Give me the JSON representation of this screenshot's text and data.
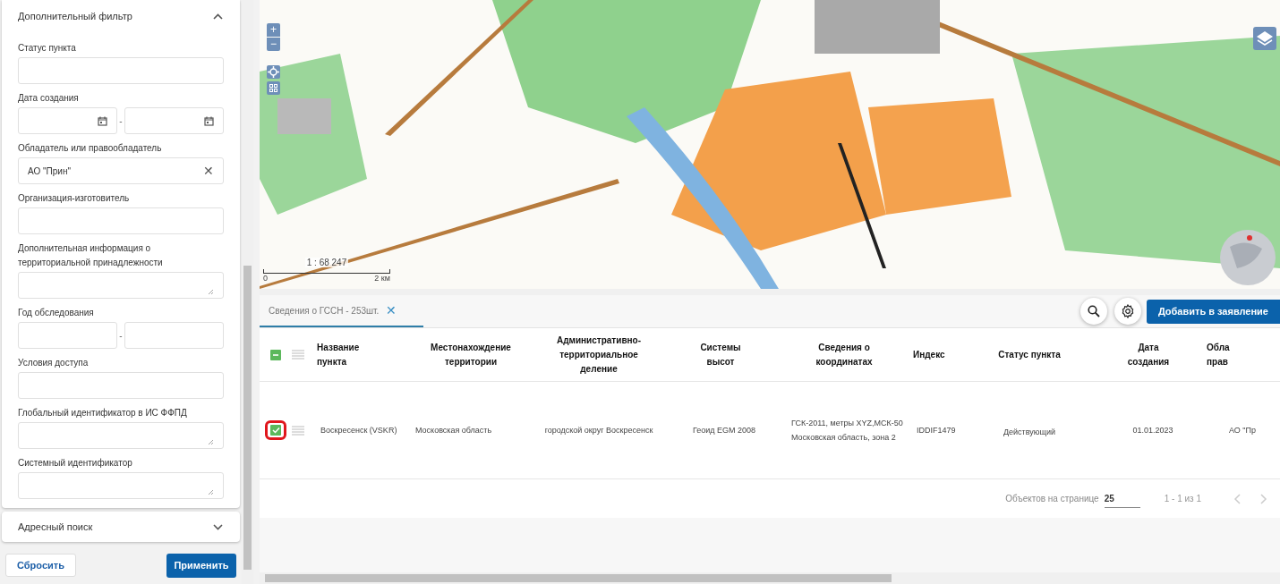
{
  "filter_panel": {
    "title": "Дополнительный фильтр",
    "expanded": true,
    "fields": [
      {
        "kind": "input",
        "label": "Статус пункта"
      },
      {
        "kind": "date_range",
        "label": "Дата создания",
        "separator": "-"
      },
      {
        "kind": "clearable",
        "label": "Обладатель или правообладатель",
        "value": "АО \"Прин\"",
        "clear": "✕"
      },
      {
        "kind": "input",
        "label": "Организация-изготовитель"
      },
      {
        "kind": "textarea",
        "label": "Дополнительная информация о территориальной принадлежности"
      },
      {
        "kind": "range",
        "label": "Год обследования",
        "separator": "-"
      },
      {
        "kind": "input",
        "label": "Условия доступа"
      },
      {
        "kind": "textarea",
        "label": "Глобальный идентификатор в ИС ФФПД"
      },
      {
        "kind": "textarea",
        "label": "Системный идентификатор"
      }
    ]
  },
  "address_panel": {
    "title": "Адресный поиск",
    "expanded": false
  },
  "buttons": {
    "reset": "Сбросить",
    "apply": "Применить"
  },
  "map": {
    "zoom_in": "+",
    "zoom_out": "−",
    "scale": {
      "ratio": "1 : 68 247",
      "start": "0",
      "end": "2 км"
    }
  },
  "tabs": [
    {
      "label": "Сведения о ГССН - 253шт.",
      "selected": true,
      "close": "✕"
    }
  ],
  "toolbar": {
    "add_button": "Добавить в заявление"
  },
  "table": {
    "select_all": {
      "indeterminate": true
    },
    "columns": [
      "Название\nпункта",
      "Местонахождение\nтерритории",
      "Административно-\nтерриториальное\nделение",
      "Системы\nвысот",
      "Сведения о\nкоординатах",
      "Индекс",
      "Статус пункта",
      "Дата\nсоздания",
      "Обла\nправ"
    ],
    "rows": [
      {
        "checked": true,
        "highlighted": true,
        "cells": [
          "Воскресенск (VSKR)",
          "Московская область",
          "городской округ Воскресенск",
          "Геоид EGM 2008",
          "ГСК-2011, метры XYZ,МСК-50 Московская область, зона 2",
          "IDDIF1479",
          "Действующий",
          "01.01.2023",
          "АО \"Пр"
        ]
      }
    ]
  },
  "pagination": {
    "per_page_label": "Объектов на странице",
    "per_page": "25",
    "range": "1 - 1 из 1",
    "prev_disabled": true,
    "next_disabled": true
  }
}
